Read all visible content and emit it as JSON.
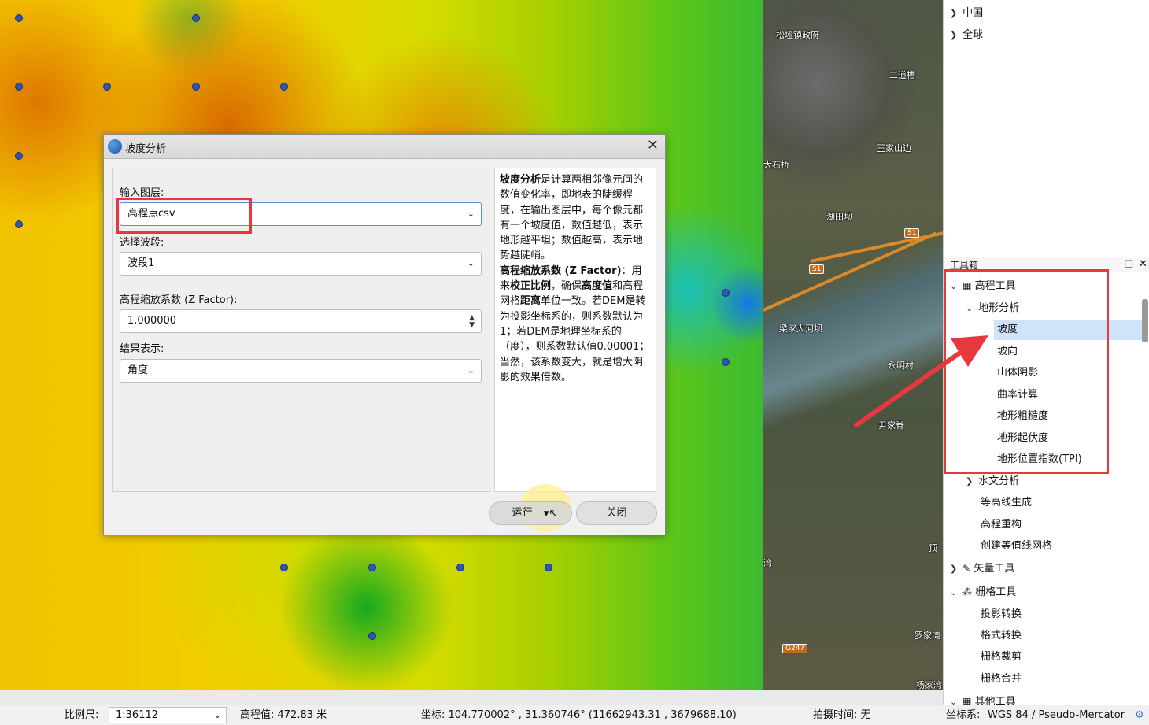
{
  "dialog": {
    "title": "坡度分析",
    "input_layer_label": "输入图层:",
    "input_layer_value": "高程点csv",
    "band_label": "选择波段:",
    "band_value": "波段1",
    "zfactor_label": "高程缩放系数 (Z Factor):",
    "zfactor_value": "1.000000",
    "result_label": "结果表示:",
    "result_value": "角度",
    "run_button": "运行",
    "close_button": "关闭",
    "help": {
      "p1_bold": "坡度分析",
      "p1_text": "是计算两相邻像元间的数值变化率，即地表的陡缓程度，在输出图层中，每个像元都有一个坡度值，数值越低，表示地形越平坦；数值越高，表示地势越陡峭。",
      "p2_bold1": "高程缩放系数 (Z Factor)",
      "p2_text1": "：用来",
      "p2_bold2": "校正比例",
      "p2_text2": "，确保",
      "p2_bold3": "高度值",
      "p2_text3": "和高程网格",
      "p2_bold4": "距离",
      "p2_text4": "单位一致。若DEM是转为投影坐标系的，则系数默认为1；若DEM是地理坐标系的（度），则系数默认值0.00001；当然，该系数变大，就是增大阴影的效果倍数。"
    }
  },
  "map_labels": [
    "松垭镇政府",
    "二道槽",
    "王家山边",
    "大石桥",
    "湖田坝",
    "梁家大河坝",
    "永明村",
    "尹家脊",
    "罗家湾",
    "杨家湾",
    "顶",
    "湾"
  ],
  "road_shields": [
    "S1",
    "S1",
    "G247"
  ],
  "layer_tree": {
    "items": [
      {
        "label": "中国"
      },
      {
        "label": "全球"
      }
    ]
  },
  "toolbox": {
    "title": "工具箱",
    "elevation_tools": "高程工具",
    "terrain_analysis": "地形分析",
    "terrain_items": [
      "坡度",
      "坡向",
      "山体阴影",
      "曲率计算",
      "地形粗糙度",
      "地形起伏度",
      "地形位置指数(TPI)"
    ],
    "hydro": "水文分析",
    "contour": "等高线生成",
    "dem_rebuild": "高程重构",
    "isoline_grid": "创建等值线网格",
    "vector_tools": "矢量工具",
    "raster_tools": "栅格工具",
    "raster_items": [
      "投影转换",
      "格式转换",
      "栅格裁剪",
      "栅格合并"
    ],
    "other_tools": "其他工具"
  },
  "status": {
    "scale_label": "比例尺:",
    "scale_value": "1:36112",
    "elevation": "高程值: 472.83 米",
    "coords": "坐标: 104.770002° , 31.360746°  (11662943.31 , 3679688.10)",
    "capture_time": "拍摄时间: 无",
    "crs_label": "坐标系:",
    "crs_value": "WGS 84 / Pseudo-Mercator"
  },
  "colors": {
    "highlight": "#cfe3fb",
    "annotation_red": "#e8383f",
    "point_blue": "#2d56b6"
  }
}
